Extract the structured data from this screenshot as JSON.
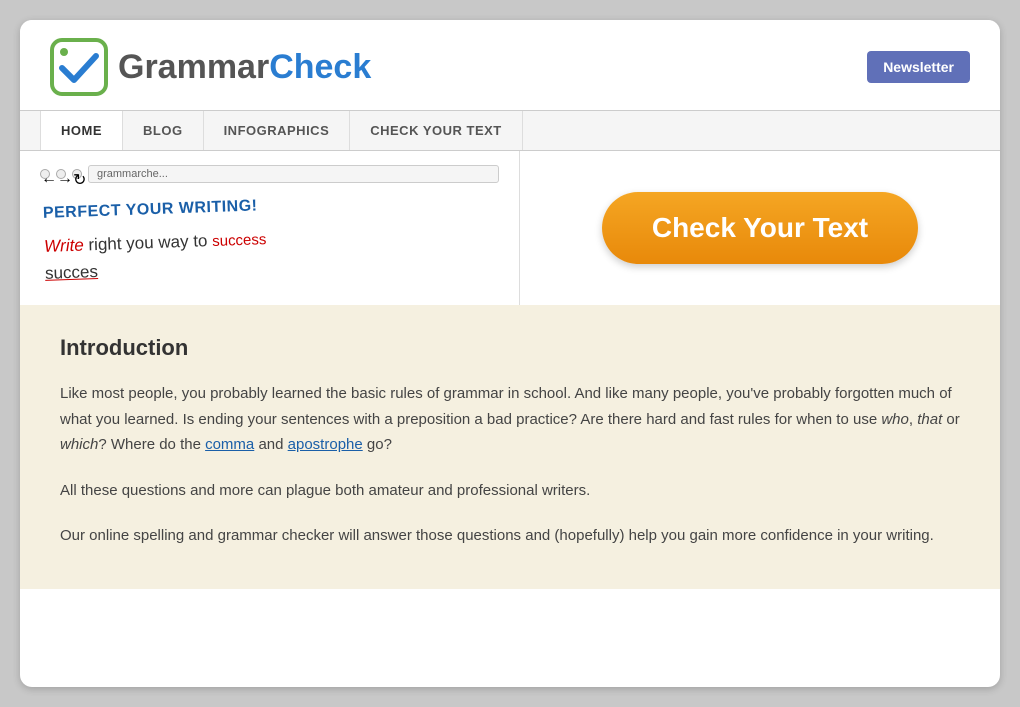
{
  "header": {
    "logo_grammar": "Grammar",
    "logo_check": "Check",
    "newsletter_label": "Newsletter"
  },
  "nav": {
    "items": [
      {
        "label": "HOME",
        "active": true
      },
      {
        "label": "BLOG",
        "active": false
      },
      {
        "label": "INFOGRAPHICS",
        "active": false
      },
      {
        "label": "CHECK YOUR TEXT",
        "active": false
      }
    ]
  },
  "hero": {
    "browser_url": "grammarche...",
    "tagline": "PERFECT YOUR WRITING!",
    "sentence_write": "Write",
    "sentence_rest": " right you way to ",
    "sentence_success_red": "success",
    "sentence_succes_underline": "succes",
    "check_btn_label": "Check Your Text"
  },
  "content": {
    "heading": "Introduction",
    "para1": "Like most people, you probably learned the basic rules of grammar in school. And like many people, you've probably forgotten much of what you learned. Is ending your sentences with a preposition a bad practice? Are there hard and fast rules for when to use ",
    "para1_italic1": "who",
    "para1_comma": ", ",
    "para1_italic2": "that",
    "para1_or": " or ",
    "para1_italic3": "which",
    "para1_end": "? Where do the ",
    "para1_link1": "comma",
    "para1_and": " and ",
    "para1_link2": "apostrophe",
    "para1_go": " go?",
    "para2": "All these questions and more can plague both amateur and professional writers.",
    "para3": "Our online spelling and grammar checker will answer those questions and (hopefully) help you gain more confidence in your writing."
  }
}
